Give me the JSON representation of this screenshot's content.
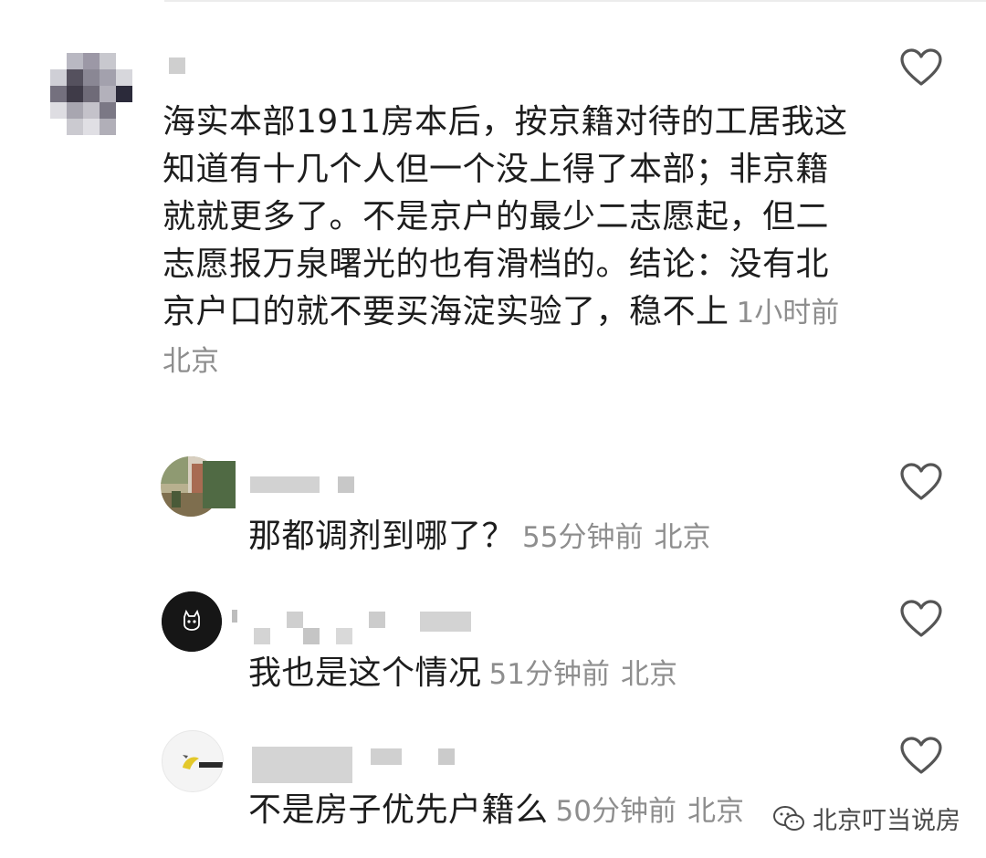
{
  "comments": [
    {
      "text": "海实本部1911房本后，按京籍对待的工居我这知道有十几个人但一个没上得了本部；非京籍就就更多了。不是京户的最少二志愿起，但二志愿报万泉曙光的也有滑档的。结论：没有北京户口的就不要买海淀实验了，稳不上",
      "time": "1小时前",
      "location": "北京",
      "avatar_icon": "blurred-avatar-icon",
      "like_icon": "heart-outline-icon"
    },
    {
      "text": "那都调剂到哪了？",
      "time": "55分钟前",
      "location": "北京",
      "avatar_icon": "photo-avatar-icon",
      "like_icon": "heart-outline-icon"
    },
    {
      "text": "我也是这个情况",
      "time": "51分钟前",
      "location": "北京",
      "avatar_icon": "cat-avatar-icon",
      "like_icon": "heart-outline-icon"
    },
    {
      "text": "不是房子优先户籍么",
      "time": "50分钟前",
      "location": "北京",
      "avatar_icon": "yellow-logo-avatar-icon",
      "like_icon": "heart-outline-icon"
    }
  ],
  "watermark": {
    "text": "北京叮当说房",
    "icon": "wechat-icon"
  },
  "colors": {
    "text": "#1d1d1d",
    "meta": "#8e8e8e",
    "icon": "#555555",
    "mosaic": "#d6d6d6"
  }
}
